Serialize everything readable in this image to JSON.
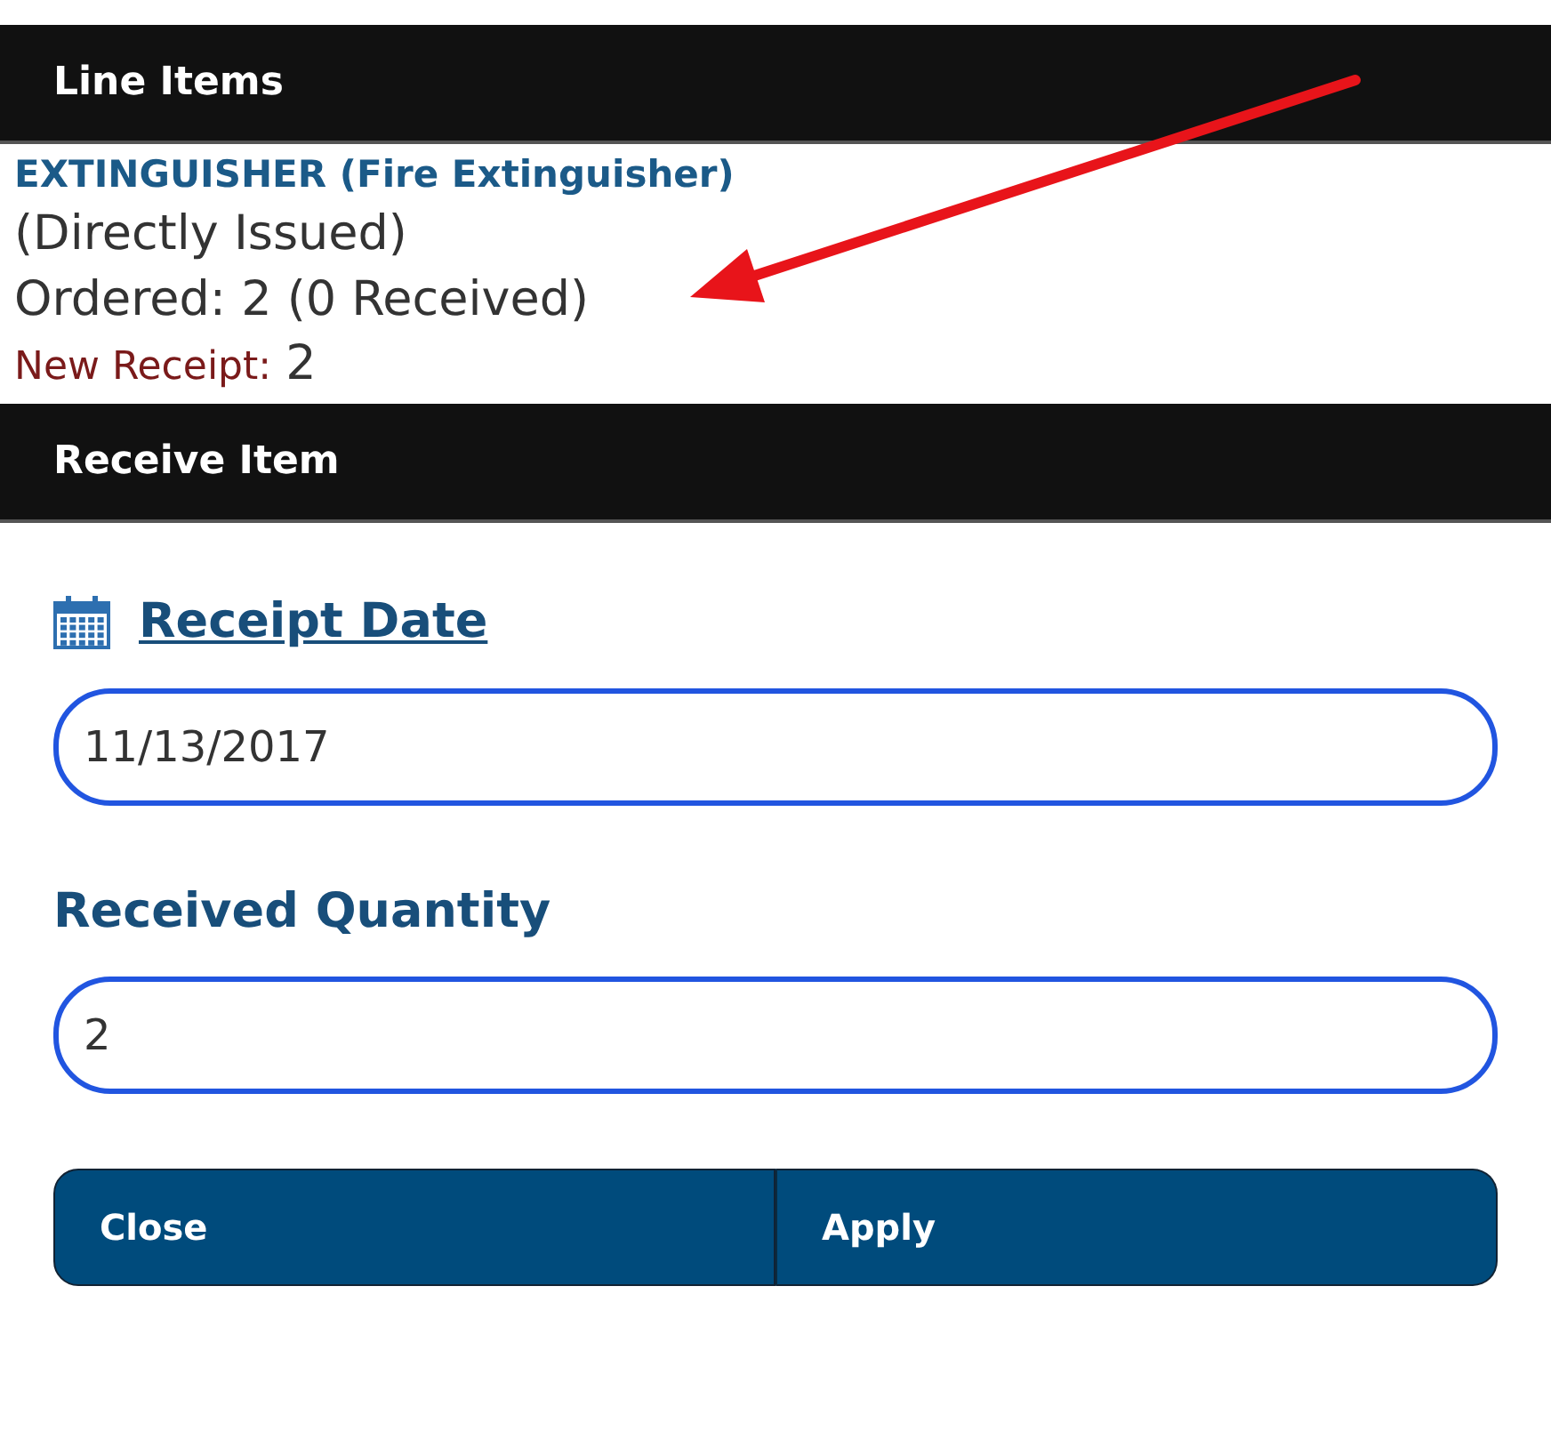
{
  "line_items": {
    "title": "Line Items",
    "item": {
      "name": "EXTINGUISHER (Fire Extinguisher)",
      "issue": "(Directly Issued)",
      "ordered": "Ordered: 2 (0 Received)",
      "new_receipt_label": "New Receipt:",
      "new_receipt_value": "2"
    }
  },
  "receive_item": {
    "title": "Receive Item",
    "fields": [
      {
        "kind": "date",
        "label": "Receipt Date",
        "value": "11/13/2017"
      },
      {
        "kind": "number",
        "label": "Received Quantity",
        "value": "2"
      }
    ],
    "buttons": [
      "Close",
      "Apply"
    ]
  }
}
